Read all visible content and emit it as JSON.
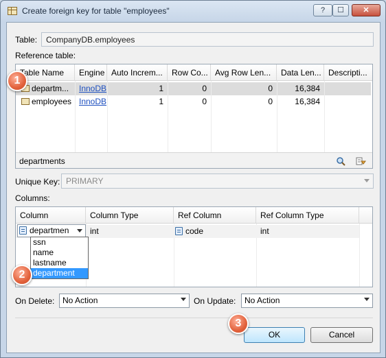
{
  "window": {
    "title": "Create foreign key for table \"employees\"",
    "controls": [
      "?",
      "☐",
      "✕"
    ]
  },
  "table": {
    "label": "Table:",
    "value": "CompanyDB.employees"
  },
  "reference": {
    "label": "Reference table:",
    "columns": [
      "Table Name",
      "Engine",
      "Auto Increm...",
      "Row Co...",
      "Avg Row Len...",
      "Data Len...",
      "Descripti..."
    ],
    "rows": [
      {
        "name": "departm...",
        "engine": "InnoDB",
        "auto_inc": "1",
        "row_count": "0",
        "avg_row_len": "0",
        "data_len": "16,384",
        "desc": ""
      },
      {
        "name": "employees",
        "engine": "InnoDB",
        "auto_inc": "1",
        "row_count": "0",
        "avg_row_len": "0",
        "data_len": "16,384",
        "desc": ""
      }
    ],
    "footer": "departments"
  },
  "unique_key": {
    "label": "Unique Key:",
    "value": "PRIMARY"
  },
  "columns_section": {
    "label": "Columns:",
    "headers": [
      "Column",
      "Column Type",
      "Ref Column",
      "Ref Column Type"
    ],
    "row": {
      "column": "departmen",
      "type": "int",
      "ref_column": "code",
      "ref_type": "int"
    },
    "dropdown_options": [
      "ssn",
      "name",
      "lastname",
      "department"
    ],
    "selected_option": "department"
  },
  "on_delete": {
    "label": "On Delete:",
    "value": "No Action"
  },
  "on_update": {
    "label": "On Update:",
    "value": "No Action"
  },
  "buttons": {
    "ok": "OK",
    "cancel": "Cancel"
  },
  "badges": [
    "1",
    "2",
    "3"
  ]
}
